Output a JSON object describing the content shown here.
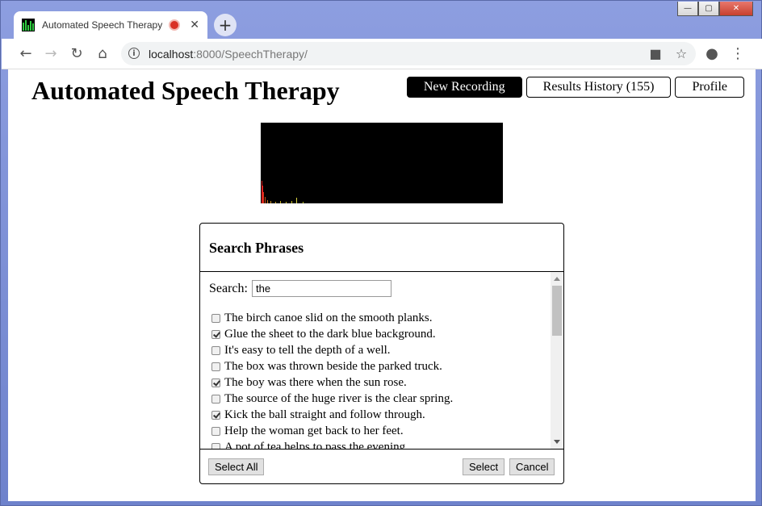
{
  "browser": {
    "tab_title": "Automated Speech Therapy",
    "tab_close": "✕",
    "new_tab": "+",
    "url_host": "localhost",
    "url_path": ":8000/SpeechTherapy/",
    "window_controls": [
      "—",
      "▢",
      "✕"
    ]
  },
  "header": {
    "title": "Automated Speech Therapy",
    "nav": [
      {
        "label": "New Recording",
        "active": true
      },
      {
        "label": "Results History (155)",
        "active": false
      },
      {
        "label": "Profile",
        "active": false
      }
    ]
  },
  "dialog": {
    "title": "Search Phrases",
    "search_label": "Search:",
    "search_value": "the",
    "phrases": [
      {
        "text": "The birch canoe slid on the smooth planks.",
        "checked": false
      },
      {
        "text": "Glue the sheet to the dark blue background.",
        "checked": true
      },
      {
        "text": "It's easy to tell the depth of a well.",
        "checked": false
      },
      {
        "text": "The box was thrown beside the parked truck.",
        "checked": false
      },
      {
        "text": "The boy was there when the sun rose.",
        "checked": true
      },
      {
        "text": "The source of the huge river is the clear spring.",
        "checked": false
      },
      {
        "text": "Kick the ball straight and follow through.",
        "checked": true
      },
      {
        "text": "Help the woman get back to her feet.",
        "checked": false
      },
      {
        "text": "A pot of tea helps to pass the evening.",
        "checked": false
      }
    ],
    "select_all_label": "Select All",
    "select_label": "Select",
    "cancel_label": "Cancel"
  },
  "colors": {
    "accent_active": "#000000",
    "visualizer_bg": "#000000",
    "recording_dot": "#d93025"
  }
}
